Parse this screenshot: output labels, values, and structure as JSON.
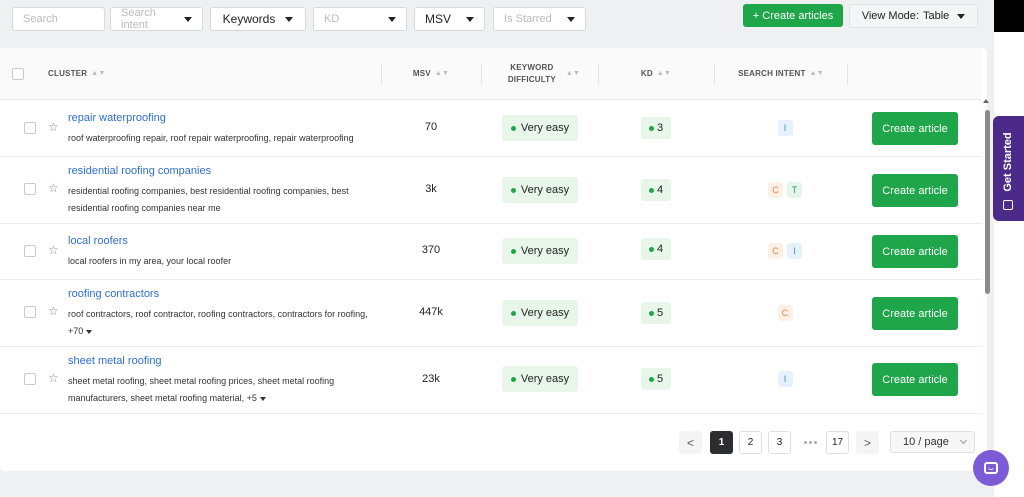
{
  "filters": {
    "search_placeholder": "Search",
    "search_intent_placeholder": "Search intent",
    "keywords_label": "Keywords",
    "kd_placeholder": "KD",
    "msv_label": "MSV",
    "starred_placeholder": "Is Starred"
  },
  "toolbar": {
    "create_articles": "+ Create articles",
    "view_mode_label": "View Mode:",
    "view_mode_value": "Table"
  },
  "columns": {
    "cluster": "Cluster",
    "msv": "MSV",
    "keyword_difficulty": "Keyword Difficulty",
    "kd": "KD",
    "search_intent": "Search Intent"
  },
  "rows": [
    {
      "title": "repair waterproofing",
      "keywords": "roof waterproofing repair, roof repair waterproofing, repair waterproofing",
      "more": "",
      "msv": "70",
      "difficulty": "Very easy",
      "kd": "3",
      "intents": [
        "I"
      ],
      "action": "Create article"
    },
    {
      "title": "residential roofing companies",
      "keywords": "residential roofing companies, best residential roofing companies, best residential roofing companies near me",
      "more": "",
      "msv": "3k",
      "difficulty": "Very easy",
      "kd": "4",
      "intents": [
        "C",
        "T"
      ],
      "action": "Create article"
    },
    {
      "title": "local roofers",
      "keywords": "local roofers in my area, your local roofer",
      "more": "",
      "msv": "370",
      "difficulty": "Very easy",
      "kd": "4",
      "intents": [
        "C",
        "I"
      ],
      "action": "Create article"
    },
    {
      "title": "roofing contractors",
      "keywords": "roof contractors, roof contractor, roofing contractors, contractors for roofing,",
      "more": "+70",
      "msv": "447k",
      "difficulty": "Very easy",
      "kd": "5",
      "intents": [
        "C"
      ],
      "action": "Create article"
    },
    {
      "title": "sheet metal roofing",
      "keywords": "sheet metal roofing, sheet metal roofing prices, sheet metal roofing manufacturers, sheet metal roofing material,",
      "more": "+5",
      "msv": "23k",
      "difficulty": "Very easy",
      "kd": "5",
      "intents": [
        "I"
      ],
      "action": "Create article"
    }
  ],
  "pagination": {
    "prev": "<",
    "pages": [
      "1",
      "2",
      "3"
    ],
    "last": "17",
    "next": ">",
    "current": "1",
    "page_size": "10 / page"
  },
  "side": {
    "get_started": "Get Started"
  },
  "colors": {
    "accent_green": "#1fa54a",
    "link_blue": "#2f6fd0",
    "purple": "#4b2a8a"
  }
}
